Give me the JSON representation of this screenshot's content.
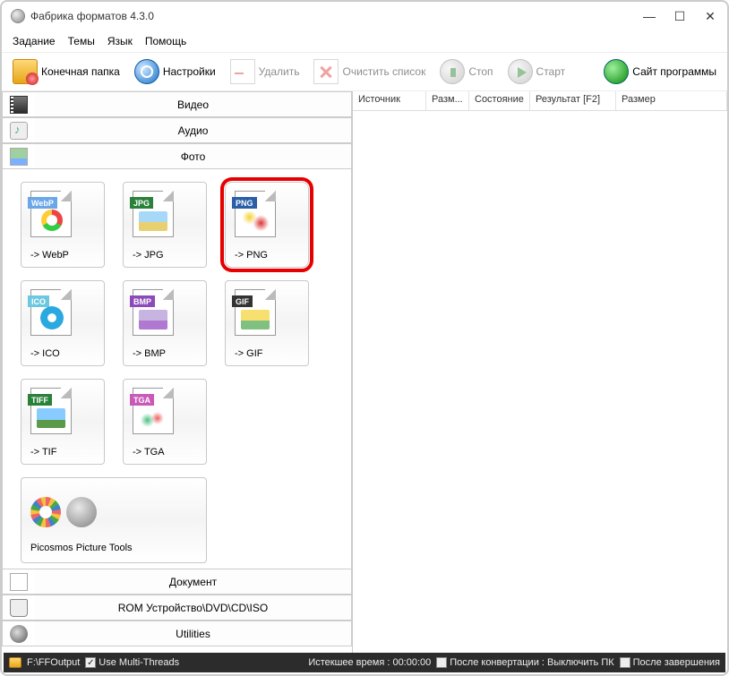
{
  "title": "Фабрика форматов 4.3.0",
  "window_buttons": {
    "min": "—",
    "max": "☐",
    "close": "✕"
  },
  "menu": [
    "Задание",
    "Темы",
    "Язык",
    "Помощь"
  ],
  "toolbar": {
    "output": "Конечная папка",
    "settings": "Настройки",
    "delete": "Удалить",
    "clear": "Очистить список",
    "stop": "Стоп",
    "start": "Старт",
    "site": "Сайт программы"
  },
  "categories": {
    "video": "Видео",
    "audio": "Аудио",
    "photo": "Фото",
    "document": "Документ",
    "rom": "ROM Устройство\\DVD\\CD\\ISO",
    "utilities": "Utilities"
  },
  "formats": {
    "webp": "-> WebP",
    "webp_badge": "WebP",
    "jpg": "-> JPG",
    "jpg_badge": "JPG",
    "png": "-> PNG",
    "png_badge": "PNG",
    "ico": "-> ICO",
    "ico_badge": "ICO",
    "bmp": "-> BMP",
    "bmp_badge": "BMP",
    "gif": "-> GIF",
    "gif_badge": "GIF",
    "tif": "-> TIF",
    "tif_badge": "TIFF",
    "tga": "-> TGA",
    "tga_badge": "TGA",
    "picosmos": "Picosmos Picture Tools"
  },
  "columns": {
    "source": "Источник",
    "size": "Разм...",
    "state": "Состояние",
    "result": "Результат [F2]",
    "outsize": "Размер"
  },
  "status": {
    "path": "F:\\FFOutput",
    "threads": "Use Multi-Threads",
    "elapsed": "Истекшее время : 00:00:00",
    "shutdown": "После конвертации : Выключить ПК",
    "after": "После завершения"
  }
}
